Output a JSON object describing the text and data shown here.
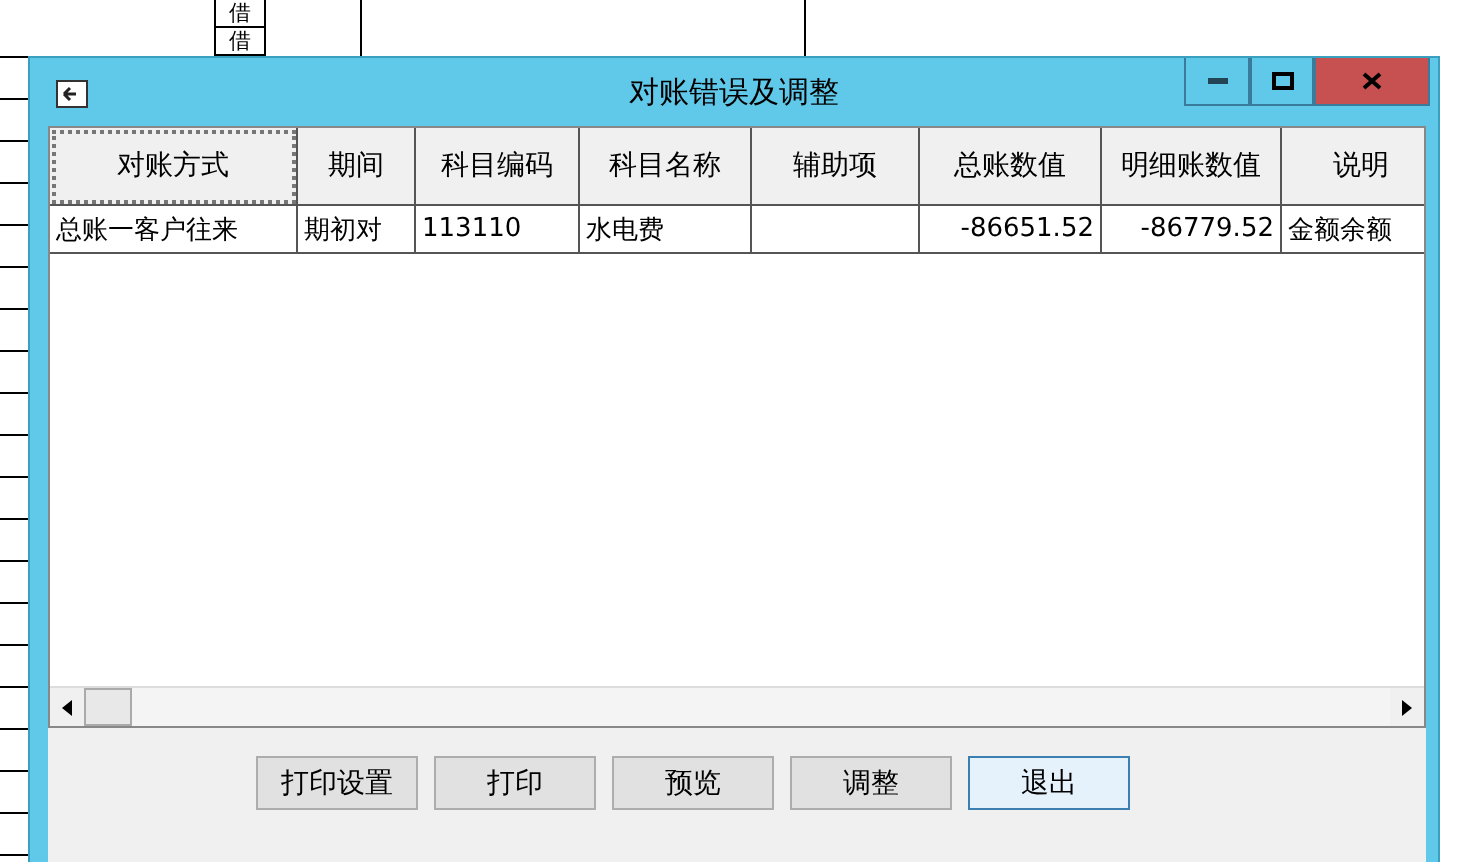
{
  "sheet": {
    "cells": [
      "借",
      "借"
    ]
  },
  "window": {
    "title": "对账错误及调整"
  },
  "table": {
    "columns": [
      "对账方式",
      "期间",
      "科目编码",
      "科目名称",
      "辅助项",
      "总账数值",
      "明细账数值",
      "说明"
    ],
    "rows": [
      {
        "selected": false,
        "cells": [
          "总账一客户往来",
          "期初对",
          "113110",
          "水电费",
          "",
          "-86651.52",
          "-86779.52",
          "金额余额"
        ]
      }
    ]
  },
  "buttons": [
    {
      "label": "打印设置",
      "focused": false
    },
    {
      "label": "打印",
      "focused": false
    },
    {
      "label": "预览",
      "focused": false
    },
    {
      "label": "调整",
      "focused": false
    },
    {
      "label": "退出",
      "focused": true
    }
  ]
}
